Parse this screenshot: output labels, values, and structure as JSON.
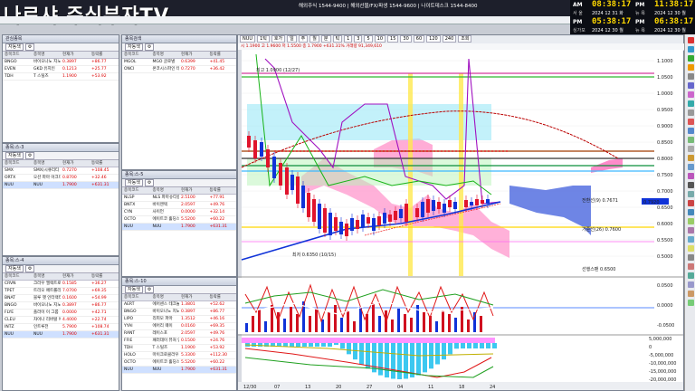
{
  "brand": "나르샤 주식부자TV",
  "ticker_marquee": "해외주식 1544-9400 | 해외선물/FX/파생 1544-9600 | 나이트데스크 1544-8400",
  "clocks": [
    {
      "ap": "AM",
      "loc": "서 울",
      "time": "08:38:17",
      "date": "2024 12 31 화"
    },
    {
      "ap": "PM",
      "loc": "뉴 욕",
      "time": "11:38:17",
      "date": "2024 12 30 월"
    },
    {
      "ap": "PM",
      "loc": "싱가포",
      "time": "05:38:17",
      "date": "2024 12 30 월"
    },
    {
      "ap": "PM",
      "loc": "뉴 욕",
      "time": "06:38:17",
      "date": "2024 12 30 월"
    }
  ],
  "panels": [
    {
      "title": "관심종목",
      "tab": "자동색",
      "cols": [
        "종목코드",
        "종목명",
        "현재가",
        "등락률"
      ],
      "rows": [
        [
          "BNGO",
          "바이오나노 지노믹스",
          "0.3897",
          "+86.77"
        ],
        [
          "EVEN",
          "GKD 유지인",
          "0.1213",
          "+25.77"
        ],
        [
          "TDH",
          "T 스틸즈",
          "1.1900",
          "+53.92"
        ]
      ]
    },
    {
      "title": "종목검색",
      "tab": "자동색",
      "cols": [
        "종목코드",
        "종목명",
        "현재가",
        "등락률"
      ],
      "rows": [
        [
          "MGOL",
          "MGO 글로벌",
          "0.6399",
          "+41.45"
        ],
        [
          "ONCI",
          "온코시스파인 테라피스",
          "0.7270",
          "+36.42"
        ]
      ]
    },
    {
      "title": "종목:스-3",
      "tab": "자동색",
      "cols": [
        "종목코드",
        "종목명",
        "현재가",
        "등락률"
      ],
      "rows": [
        [
          "SMX",
          "SMX(시큐리티 매터스)",
          "0.7270",
          "+108.45"
        ],
        [
          "ORTX",
          "오션 파마 아크테라피",
          "0.8700",
          "+32.46"
        ],
        [
          "NUU",
          "NUU",
          "1.7900",
          "+631.31"
        ]
      ]
    },
    {
      "title": "종목:스-5",
      "tab": "자동색",
      "cols": [
        "종목코드",
        "종목명",
        "현재가",
        "등락률"
      ],
      "rows": [
        [
          "NLSP",
          "NLS 파마슈티컬스",
          "2.5100",
          "+77.91"
        ],
        [
          "BNTX",
          "바이엔텍",
          "2.0597",
          "+49.76"
        ],
        [
          "CYN",
          "사이언",
          "0.0000",
          "+32.14"
        ],
        [
          "OCTO",
          "에이트코 홀딩스",
          "5.5200",
          "+60.22"
        ],
        [
          "NUU",
          "NUU",
          "1.7900",
          "+631.31"
        ]
      ]
    },
    {
      "title": "종목:스-4",
      "tab": "자동색",
      "cols": [
        "종목코드",
        "종목명",
        "현재가",
        "등락률"
      ],
      "rows": [
        [
          "CRVN",
          "크라우 엘렉트로닉스",
          "0.1585",
          "+36.27"
        ],
        [
          "TPET",
          "트리오 페트롤리엄",
          "7.0700",
          "+69.35"
        ],
        [
          "BNAT",
          "블루 햇 인터랙티브",
          "0.1600",
          "+54.99"
        ],
        [
          "BNGO",
          "바이오나노 지노믹스",
          "0.3897",
          "+86.77"
        ],
        [
          "FLYE",
          "플라이 이 그룹",
          "0.0000",
          "+42.71"
        ],
        [
          "CLEU",
          "차이나 리버럴 에듀",
          "4.4000",
          "+22.74"
        ],
        [
          "INTZ",
          "인트루전",
          "5.7900",
          "+108.74"
        ],
        [
          "NUU",
          "NUU",
          "1.7900",
          "+631.31"
        ]
      ]
    },
    {
      "title": "종목:스-10",
      "tab": "자동색",
      "cols": [
        "종목코드",
        "종목명",
        "현재가",
        "등락률"
      ],
      "rows": [
        [
          "AERT",
          "에어센스 테크놀로지",
          "1.3801",
          "+52.62"
        ],
        [
          "BNGO",
          "바이오나노 지노믹스",
          "0.3897",
          "+86.77"
        ],
        [
          "LIPO",
          "리피모 파마",
          "1.3512",
          "+46.16"
        ],
        [
          "YYAI",
          "에어리 웨이",
          "0.0160",
          "+69.35"
        ],
        [
          "RANT",
          "레이스포",
          "2.0597",
          "+49.76"
        ],
        [
          "FFIE",
          "패러데이 퓨처 인텔리",
          "0.1500",
          "+24.76"
        ],
        [
          "TDH",
          "T 스틸즈",
          "1.1900",
          "+53.92"
        ],
        [
          "HOLO",
          "마이크로클라우드 홀",
          "5.3300",
          "+112.30"
        ],
        [
          "OCTO",
          "에이트코 홀딩스",
          "5.5200",
          "+60.22"
        ],
        [
          "NUU",
          "NUU",
          "1.7900",
          "+631.31"
        ]
      ]
    }
  ],
  "chart": {
    "toolbar": [
      "NUU",
      "1틱",
      "호가",
      "일",
      "주",
      "월",
      "분",
      "틱",
      "1",
      "3",
      "5",
      "10",
      "15",
      "30",
      "60",
      "120",
      "240",
      "조회"
    ],
    "info": "시 1.1900 고 1.9600 저 1.5500 종 1.7900 +631.31% 거래량 91,349,610",
    "price_labels": [
      "1.1000",
      "1.0500",
      "1.0000",
      "0.9500",
      "0.9000",
      "0.8500",
      "0.8000",
      "0.7500",
      "0.7000",
      "0.6500",
      "0.6000",
      "0.5500",
      "0.5000"
    ],
    "annotations": [
      "최고 1.0900 (12/27)",
      "최저 0.6350 (10/15)",
      "전환선(9) 0.7671",
      "기준선(26) 0.7600",
      "선행스팬 0.6500"
    ],
    "macd_labels": [
      "0.0500",
      "0.0000",
      "-0.0500"
    ],
    "osc_labels": [
      "5,000,000",
      "0",
      "-5,000,000",
      "-10,000,000",
      "-15,000,000",
      "-20,000,000"
    ],
    "date_labels": [
      "12/30",
      "07",
      "13",
      "20",
      "27",
      "04",
      "11",
      "18",
      "24"
    ],
    "current_price": "0.7920"
  }
}
